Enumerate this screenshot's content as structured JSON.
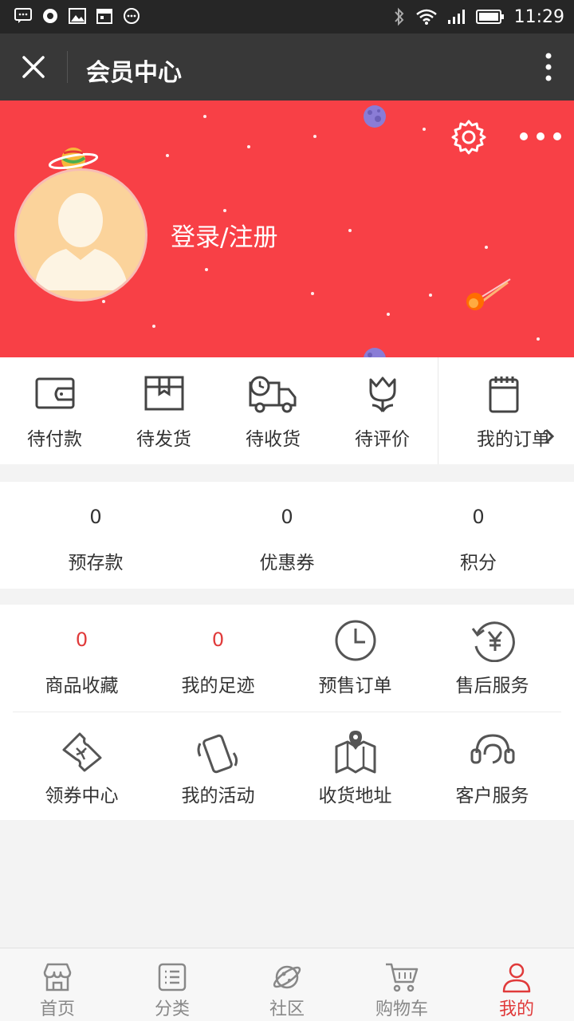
{
  "status_bar": {
    "time": "11:29",
    "icons": [
      "message-icon",
      "sync-icon",
      "image-icon",
      "calendar-icon",
      "more-circle-icon",
      "bluetooth-icon",
      "wifi-icon",
      "signal-icon",
      "battery-icon"
    ]
  },
  "title_bar": {
    "title": "会员中心",
    "icons": [
      "close-icon",
      "more-vertical-icon"
    ]
  },
  "header": {
    "login_text": "登录/注册",
    "background_color": "#f84046",
    "icons": [
      "planet-icon",
      "settings-icon",
      "more-horizontal-icon",
      "meteor-icon",
      "avatar-icon"
    ]
  },
  "orders": {
    "items": [
      {
        "label": "待付款",
        "icon": "wallet-icon"
      },
      {
        "label": "待发货",
        "icon": "package-icon"
      },
      {
        "label": "待收货",
        "icon": "truck-icon"
      },
      {
        "label": "待评价",
        "icon": "tulip-icon"
      }
    ],
    "my_orders": {
      "label": "我的订单",
      "icon": "notebook-icon"
    }
  },
  "assets": [
    {
      "value": "0",
      "label": "预存款"
    },
    {
      "value": "0",
      "label": "优惠券"
    },
    {
      "value": "0",
      "label": "积分"
    }
  ],
  "tools": {
    "row1": [
      {
        "value": "0",
        "label": "商品收藏"
      },
      {
        "value": "0",
        "label": "我的足迹"
      },
      {
        "label": "预售订单",
        "icon": "clock-icon"
      },
      {
        "label": "售后服务",
        "icon": "yen-refund-icon"
      }
    ],
    "row2": [
      {
        "label": "领券中心",
        "icon": "coupon-icon"
      },
      {
        "label": "我的活动",
        "icon": "phone-vibrate-icon"
      },
      {
        "label": "收货地址",
        "icon": "map-pin-icon"
      },
      {
        "label": "客户服务",
        "icon": "headset-icon"
      }
    ]
  },
  "tab_bar": {
    "items": [
      {
        "label": "首页",
        "icon": "store-icon"
      },
      {
        "label": "分类",
        "icon": "list-icon"
      },
      {
        "label": "社区",
        "icon": "planet-outline-icon"
      },
      {
        "label": "购物车",
        "icon": "cart-icon"
      },
      {
        "label": "我的",
        "icon": "user-icon"
      }
    ],
    "active": "我的",
    "active_color": "#e03a3a"
  }
}
